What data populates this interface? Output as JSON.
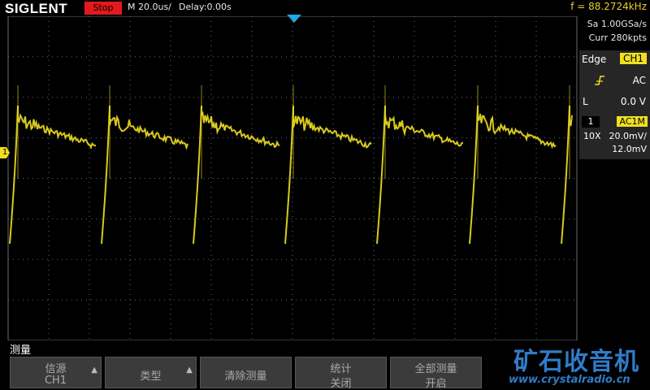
{
  "header": {
    "brand": "SIGLENT",
    "run_state": "Stop",
    "timebase": "M 20.0us/",
    "delay": "Delay:0.00s",
    "frequency": "f = 88.2724kHz"
  },
  "acquisition": {
    "sample_rate": "Sa 1.00GSa/s",
    "memory_depth": "Curr 280kpts"
  },
  "trigger": {
    "type": "Edge",
    "source": "CH1",
    "slope_icon": "rising-edge-icon",
    "coupling": "AC",
    "mode": "L",
    "level": "0.0 V"
  },
  "channel": {
    "number": "1",
    "coupling": "AC1M",
    "probe": "10X",
    "scale": "20.0mV/",
    "offset": "12.0mV",
    "marker": "1"
  },
  "menu": {
    "title": "测量",
    "softkeys": [
      {
        "line1": "信源",
        "line2": "CH1",
        "arrow": true
      },
      {
        "line1": "类型",
        "line2": "",
        "arrow": true
      },
      {
        "line1": "清除测量",
        "line2": "",
        "arrow": false
      },
      {
        "line1": "统计",
        "line2": "关闭",
        "arrow": false
      },
      {
        "line1": "全部测量",
        "line2": "开启",
        "arrow": false
      }
    ]
  },
  "watermark": {
    "title": "矿石收音机",
    "url": "www.crystalradio.cn"
  },
  "colors": {
    "trace": "#f0e020",
    "grid": "#6a6a6a",
    "trigger_marker": "#23a6e6",
    "stop_badge": "#e4191c",
    "frequency_text": "#e9cf2a",
    "watermark": "#2f7cc9"
  }
}
